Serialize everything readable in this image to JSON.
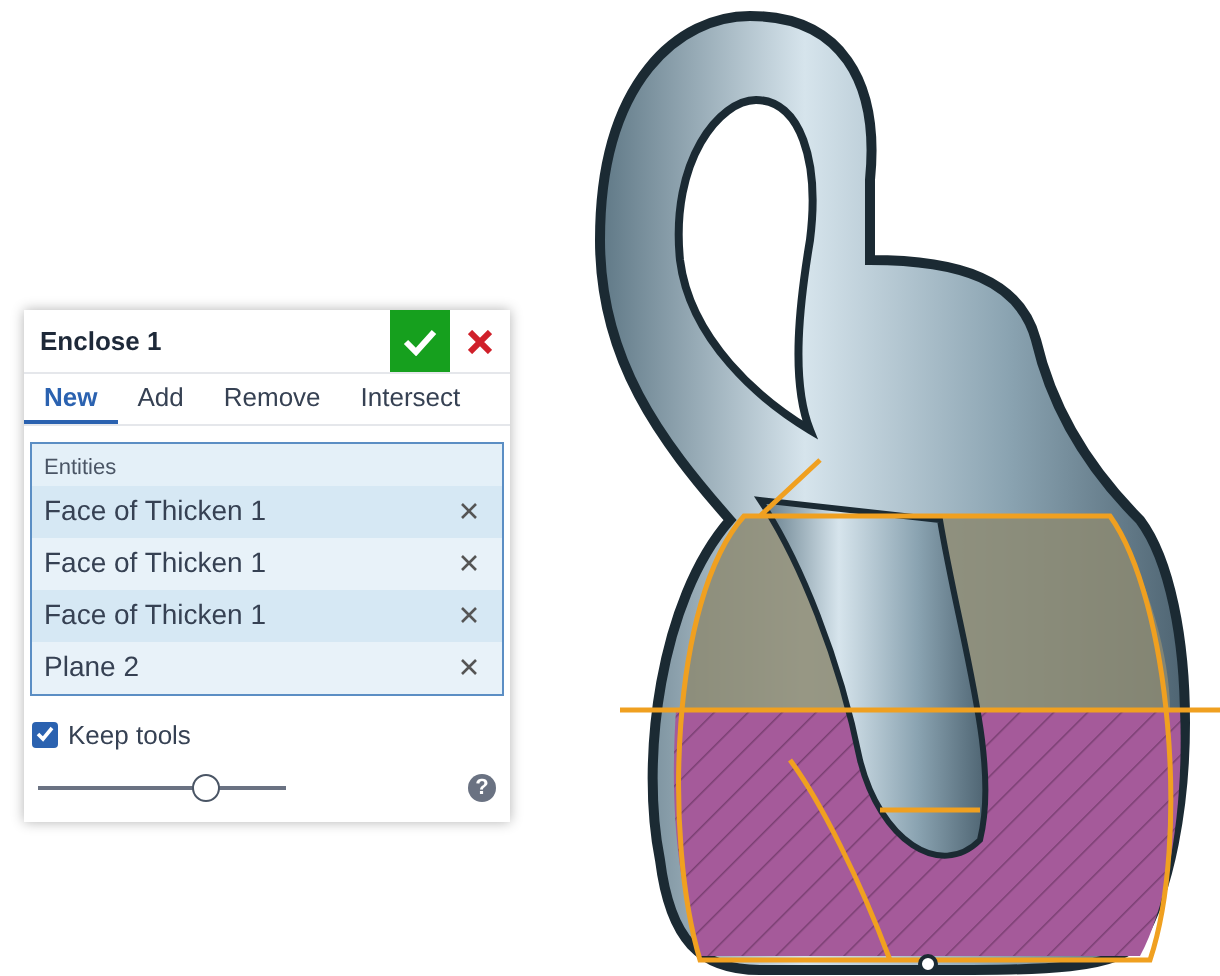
{
  "dialog": {
    "title": "Enclose 1",
    "tabs": [
      {
        "label": "New",
        "selected": true
      },
      {
        "label": "Add",
        "selected": false
      },
      {
        "label": "Remove",
        "selected": false
      },
      {
        "label": "Intersect",
        "selected": false
      }
    ],
    "entities": {
      "label": "Entities",
      "items": [
        {
          "name": "Face of Thicken 1"
        },
        {
          "name": "Face of Thicken 1"
        },
        {
          "name": "Face of Thicken 1"
        },
        {
          "name": "Plane 2"
        }
      ]
    },
    "keep_tools": {
      "label": "Keep tools",
      "checked": true
    },
    "slider": {
      "level": 0.7
    },
    "help": "?"
  }
}
